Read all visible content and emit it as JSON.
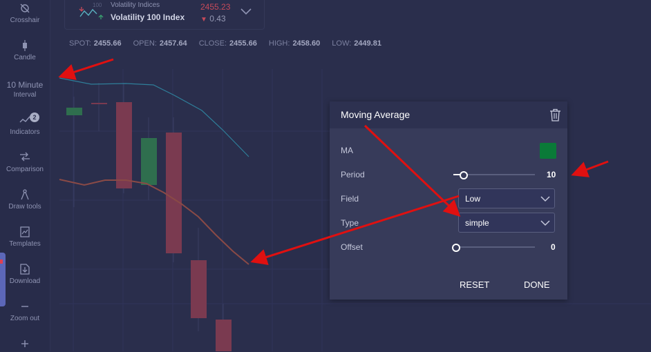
{
  "sidebar": {
    "items": [
      {
        "label": "Crosshair",
        "icon": "crosshair-icon"
      },
      {
        "label": "Candle",
        "icon": "candle-icon"
      },
      {
        "label": "Interval",
        "value": "10 Minute"
      },
      {
        "label": "Indicators",
        "icon": "indicators-icon",
        "badge": "2"
      },
      {
        "label": "Comparison",
        "icon": "comparison-icon"
      },
      {
        "label": "Draw tools",
        "icon": "draw-tools-icon"
      },
      {
        "label": "Templates",
        "icon": "templates-icon"
      },
      {
        "label": "Download",
        "icon": "download-icon"
      },
      {
        "label": "Zoom out",
        "icon": "zoom-out-icon"
      },
      {
        "label": "",
        "icon": "zoom-in-icon"
      }
    ]
  },
  "symbol": {
    "category": "Volatility Indices",
    "name": "Volatility 100 Index",
    "price": "2455.23",
    "change": "0.43",
    "icon_text": "100"
  },
  "ohlc": {
    "spot_label": "SPOT:",
    "spot": "2455.66",
    "open_label": "OPEN:",
    "open": "2457.64",
    "close_label": "CLOSE:",
    "close": "2455.66",
    "high_label": "HIGH:",
    "high": "2458.60",
    "low_label": "LOW:",
    "low": "2449.81"
  },
  "ma_panel": {
    "title": "Moving Average",
    "ma_label": "MA",
    "ma_color": "#0a7a38",
    "period_label": "Period",
    "period_value": "10",
    "field_label": "Field",
    "field_value": "Low",
    "type_label": "Type",
    "type_value": "simple",
    "offset_label": "Offset",
    "offset_value": "0",
    "reset_label": "RESET",
    "done_label": "DONE"
  },
  "colors": {
    "background": "#2a2e4c",
    "bull_candle": "#2f6e4e",
    "bear_candle": "#7a3a50",
    "ma_line": "#8a4a46",
    "upper_line": "#2f7f9a",
    "annotation_arrow": "#e01010"
  }
}
